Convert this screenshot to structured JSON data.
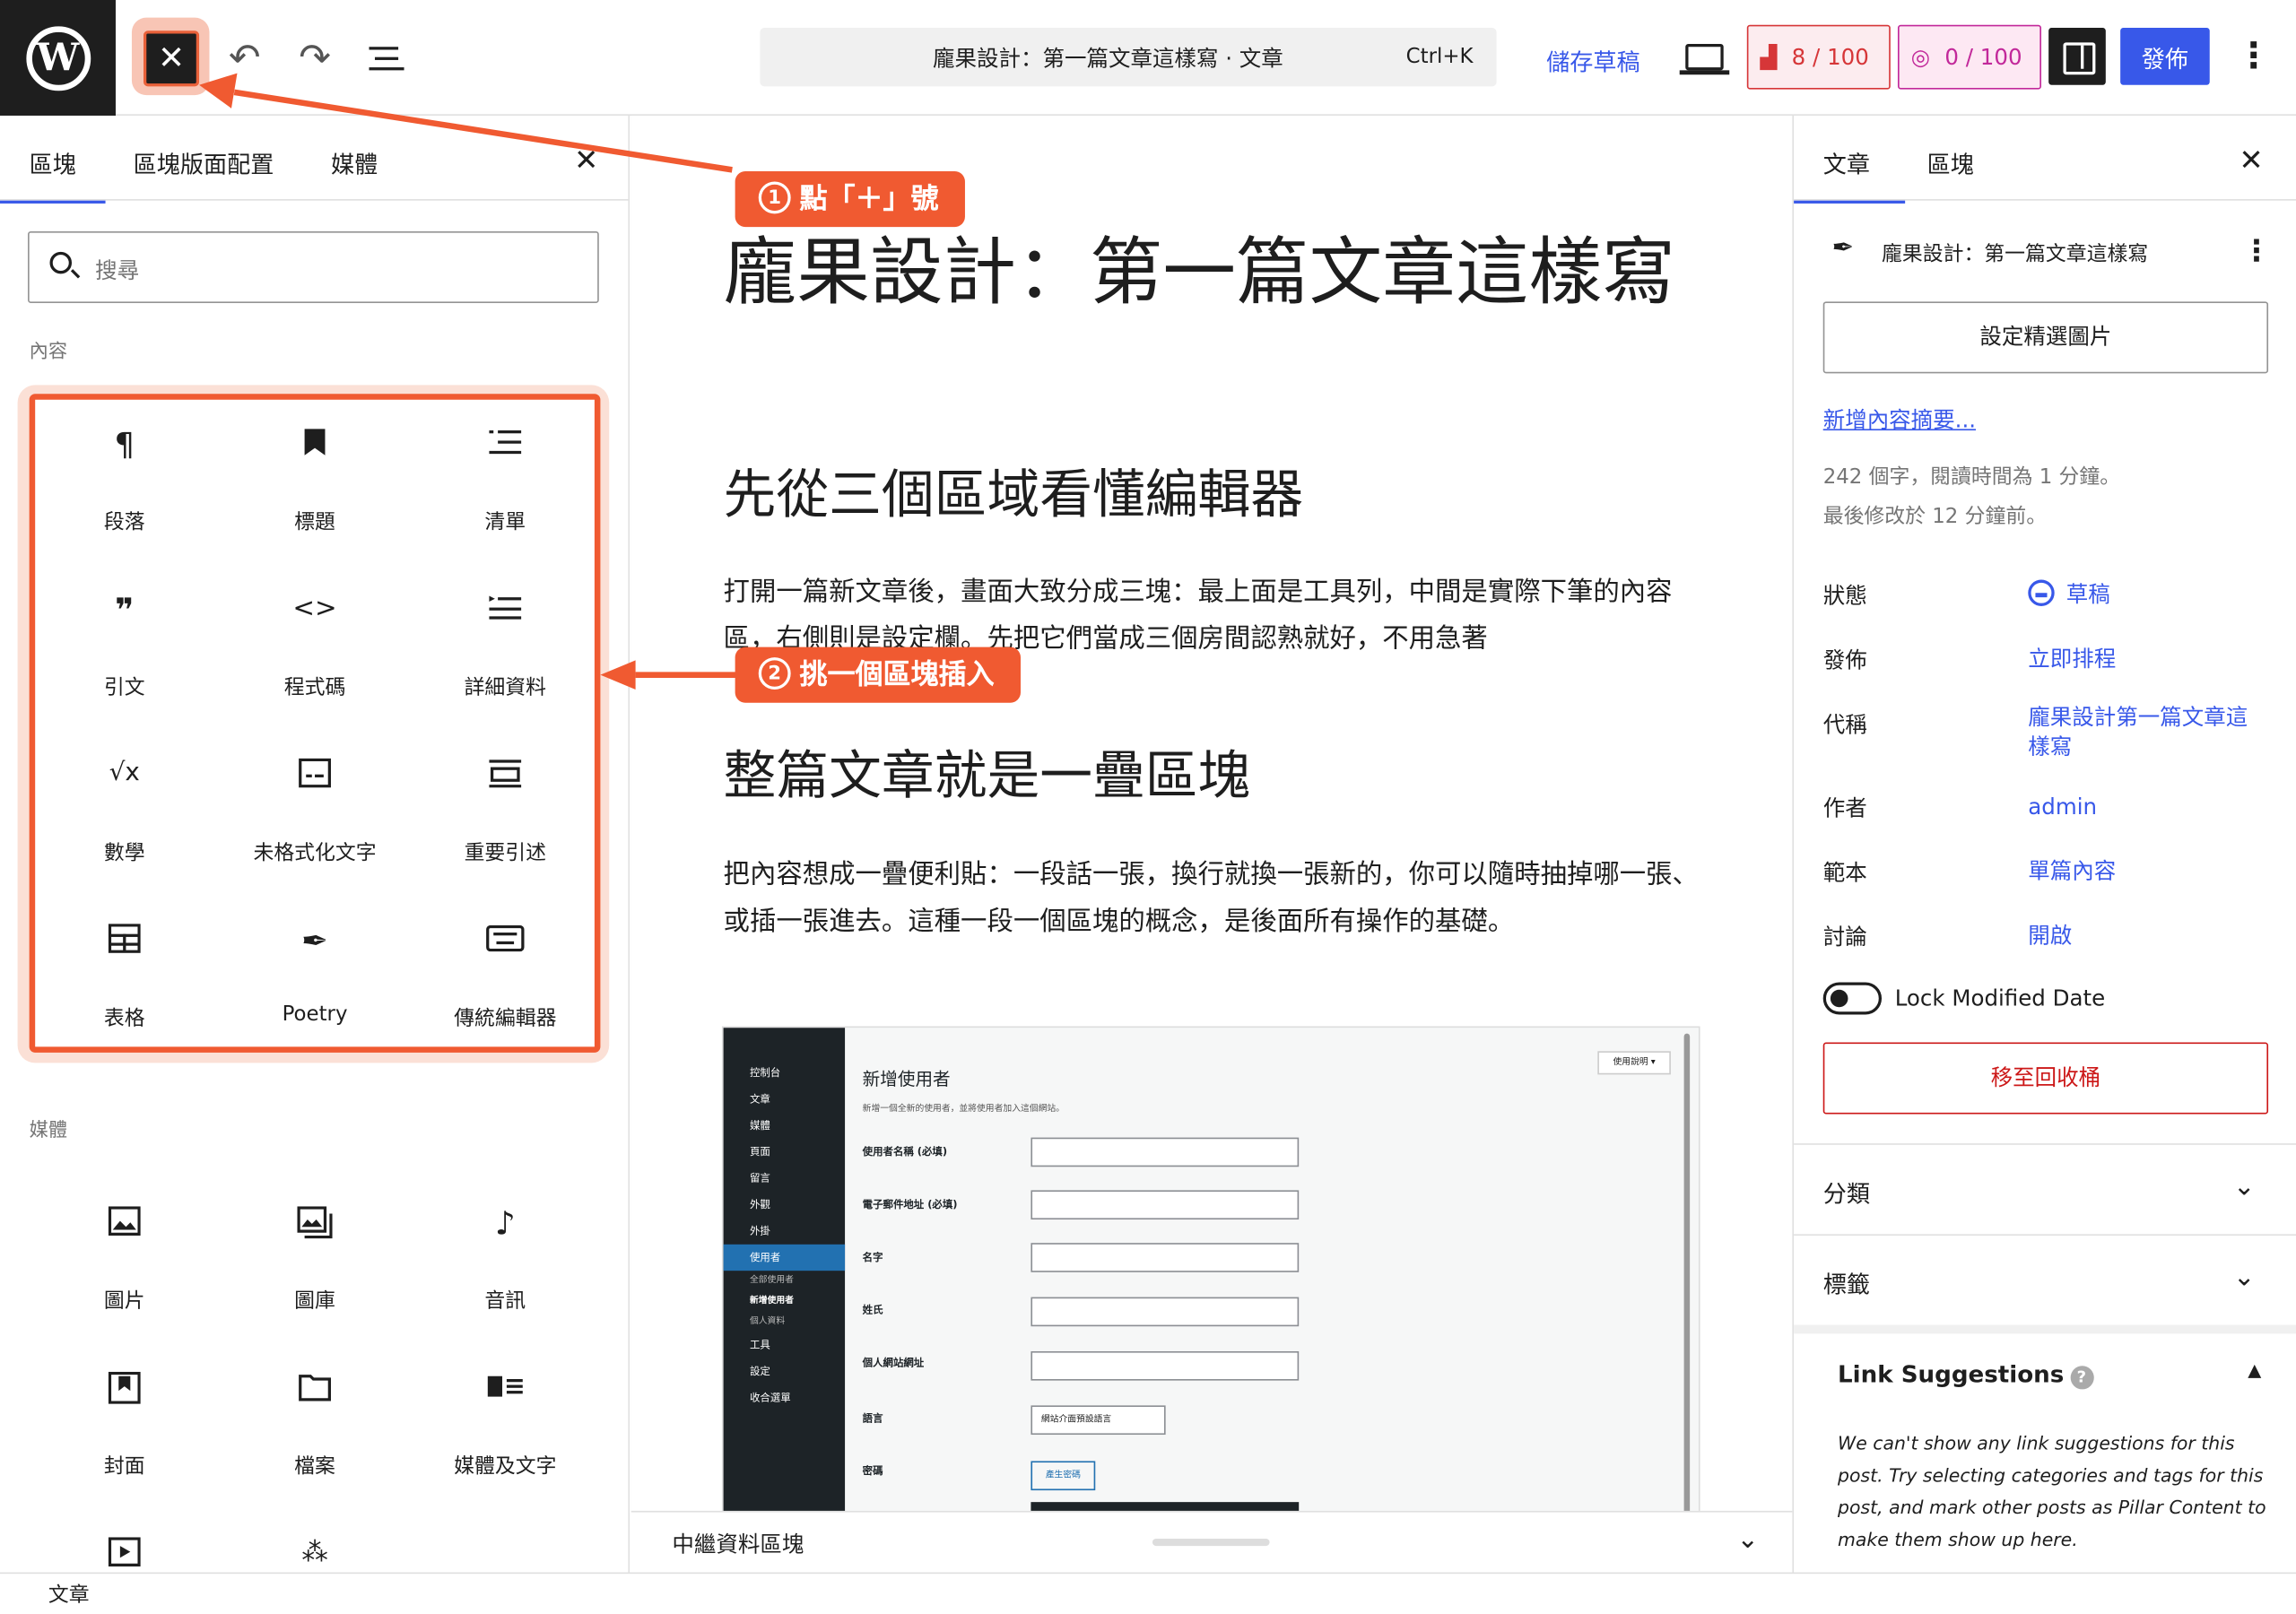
{
  "toolbar": {
    "command_title": "龐果設計：第一篇文章這樣寫 · 文章",
    "command_shortcut": "Ctrl+K",
    "save_draft": "儲存草稿",
    "score1": "8 / 100",
    "score2": "0 / 100",
    "publish": "發佈",
    "close_icon": "close-icon",
    "undo_icon": "undo-icon",
    "redo_icon": "redo-icon"
  },
  "inserter": {
    "tabs": [
      "區塊",
      "區塊版面配置",
      "媒體"
    ],
    "search_placeholder": "搜尋",
    "content_label": "內容",
    "media_label": "媒體",
    "content_blocks": [
      {
        "label": "段落",
        "icon": "paragraph-icon"
      },
      {
        "label": "標題",
        "icon": "bookmark-icon"
      },
      {
        "label": "清單",
        "icon": "list-icon"
      },
      {
        "label": "引文",
        "icon": "quote-icon"
      },
      {
        "label": "程式碼",
        "icon": "code-icon"
      },
      {
        "label": "詳細資料",
        "icon": "details-icon"
      },
      {
        "label": "數學",
        "icon": "math-icon"
      },
      {
        "label": "未格式化文字",
        "icon": "preformatted-icon"
      },
      {
        "label": "重要引述",
        "icon": "pullquote-icon"
      },
      {
        "label": "表格",
        "icon": "table-icon"
      },
      {
        "label": "Poetry",
        "icon": "feather-icon"
      },
      {
        "label": "傳統編輯器",
        "icon": "keyboard-icon"
      }
    ],
    "media_blocks": [
      {
        "label": "圖片",
        "icon": "image-icon"
      },
      {
        "label": "圖庫",
        "icon": "gallery-icon"
      },
      {
        "label": "音訊",
        "icon": "audio-icon"
      },
      {
        "label": "封面",
        "icon": "cover-icon"
      },
      {
        "label": "檔案",
        "icon": "file-icon"
      },
      {
        "label": "媒體及文字",
        "icon": "media-text-icon"
      }
    ]
  },
  "editor": {
    "post_title": "龐果設計：第一篇文章這樣寫",
    "h2_1": "先從三個區域看懂編輯器",
    "para_1": "打開一篇新文章後，畫面大致分成三塊：最上面是工具列，中間是實際下筆的內容區，右側則是設定欄。先把它們當成三個房間認熟就好，不用急著",
    "h2_2": "整篇文章就是一疊區塊",
    "para_2": "把內容想成一疊便利貼：一段話一張，換行就換一張新的，你可以隨時抽掉哪一張、或插一張進去。這種一段一個區塊的概念，是後面所有操作的基礎。",
    "footer_meta": "中繼資料區塊"
  },
  "embedded_screenshot": {
    "menu": [
      "控制台",
      "文章",
      "媒體",
      "頁面",
      "留言",
      "外觀",
      "外掛",
      "使用者",
      "全部使用者",
      "新增使用者",
      "個人資料",
      "工具",
      "設定",
      "收合選單"
    ],
    "title": "新增使用者",
    "subtitle": "新增一個全新的使用者，並將使用者加入這個網站。",
    "help": "使用說明 ▾",
    "fields": [
      "使用者名稱 (必填)",
      "電子郵件地址 (必填)",
      "名字",
      "姓氏",
      "個人網站網址",
      "語言",
      "密碼"
    ],
    "language_value": "網站介面預設語言",
    "generate_password": "產生密碼"
  },
  "settings": {
    "tabs": [
      "文章",
      "區塊"
    ],
    "post_name": "龐果設計：第一篇文章這樣寫",
    "featured_image": "設定精選圖片",
    "add_excerpt": "新增內容摘要...",
    "stats_1": "242 個字，閱讀時間為 1 分鐘。",
    "stats_2": "最後修改於 12 分鐘前。",
    "rows": [
      {
        "label": "狀態",
        "value": "草稿"
      },
      {
        "label": "發佈",
        "value": "立即排程"
      },
      {
        "label": "代稱",
        "value": "龐果設計第一篇文章這樣寫"
      },
      {
        "label": "作者",
        "value": "admin"
      },
      {
        "label": "範本",
        "value": "單篇內容"
      },
      {
        "label": "討論",
        "value": "開啟"
      }
    ],
    "lock_modified": "Lock Modified Date",
    "trash": "移至回收桶",
    "categories": "分類",
    "tags": "標籤",
    "link_suggestions_title": "Link Suggestions",
    "link_suggestions_text": "We can't show any link suggestions for this post. Try selecting categories and tags for this post, and mark other posts as Pillar Content to make them show up here."
  },
  "statusbar": {
    "breadcrumb": "文章"
  },
  "annotations": {
    "step1": "點「＋」號",
    "step1_num": "1",
    "step2": "挑一個區塊插入",
    "step2_num": "2"
  },
  "colors": {
    "accent": "#3858e9",
    "annotation": "#f05a31",
    "danger": "#cc1818"
  }
}
